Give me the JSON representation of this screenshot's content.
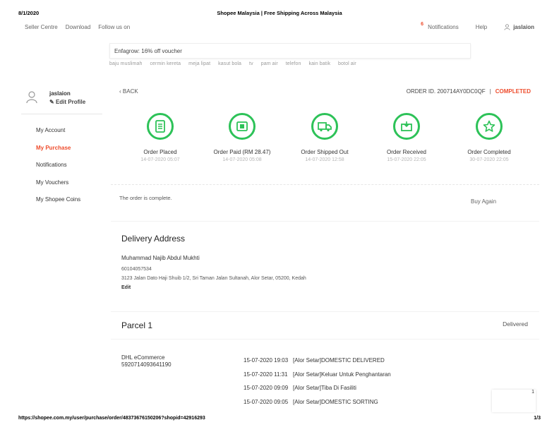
{
  "print_header": {
    "date": "8/1/2020",
    "title": "Shopee Malaysia | Free Shipping Across Malaysia"
  },
  "topnav": {
    "left": [
      "Seller Centre",
      "Download",
      "Follow us on"
    ],
    "notifications_count": "6",
    "notifications_label": "Notifications",
    "help_label": "Help",
    "username": "jaslaion"
  },
  "search": {
    "value": "Enfagrow: 16% off voucher",
    "hints": [
      "baju muslimah",
      "cermin kereta",
      "meja lipat",
      "kasut bola",
      "tv",
      "pam air",
      "telefon",
      "kain batik",
      "botol air"
    ]
  },
  "sidebar": {
    "username": "jaslaion",
    "edit_profile": "Edit Profile",
    "menu": [
      "My Account",
      "My Purchase",
      "Notifications",
      "My Vouchers",
      "My Shopee Coins"
    ]
  },
  "order": {
    "back_label": "BACK",
    "order_id_label": "ORDER ID. 200714AY0DC0QF",
    "status": "COMPLETED",
    "steps": [
      {
        "label": "Order Placed",
        "time": "14-07-2020 05:07",
        "icon": "receipt-icon"
      },
      {
        "label": "Order Paid (RM 28.47)",
        "time": "14-07-2020 05:08",
        "icon": "payment-icon"
      },
      {
        "label": "Order Shipped Out",
        "time": "14-07-2020 12:58",
        "icon": "truck-icon"
      },
      {
        "label": "Order Received",
        "time": "15-07-2020 22:05",
        "icon": "inbox-icon"
      },
      {
        "label": "Order Completed",
        "time": "30-07-2020 22:05",
        "icon": "star-icon"
      }
    ],
    "complete_message": "The order is complete.",
    "buy_again": "Buy Again"
  },
  "address": {
    "title": "Delivery Address",
    "name": "Muhammad Najib Abdul Mukhti",
    "phone": "60104057534",
    "line": "3123 Jalan Dato Haji Shuib 1/2, Sri Taman Jalan Sultanah, Alor Setar, 05200, Kedah",
    "edit": "Edit"
  },
  "parcel": {
    "title": "Parcel 1",
    "status": "Delivered",
    "carrier_name": "DHL eCommerce",
    "tracking_no": "5920714093641190",
    "events": [
      {
        "time": "15-07-2020 19:03",
        "desc": "[Alor Setar]DOMESTIC DELIVERED"
      },
      {
        "time": "15-07-2020 11:31",
        "desc": "[Alor Setar]Keluar Untuk Penghantaran"
      },
      {
        "time": "15-07-2020 09:09",
        "desc": "[Alor Setar]Tiba Di Fasiliti"
      },
      {
        "time": "15-07-2020 09:05",
        "desc": "[Alor Setar]DOMESTIC SORTING"
      }
    ]
  },
  "float_box_label": "1",
  "print_footer": {
    "url": "https://shopee.com.my/user/purchase/order/4837367615020​6?shopid=42916293",
    "page": "1/3"
  },
  "colors": {
    "accent": "#ee4d2d",
    "step_green": "#2dc258"
  }
}
